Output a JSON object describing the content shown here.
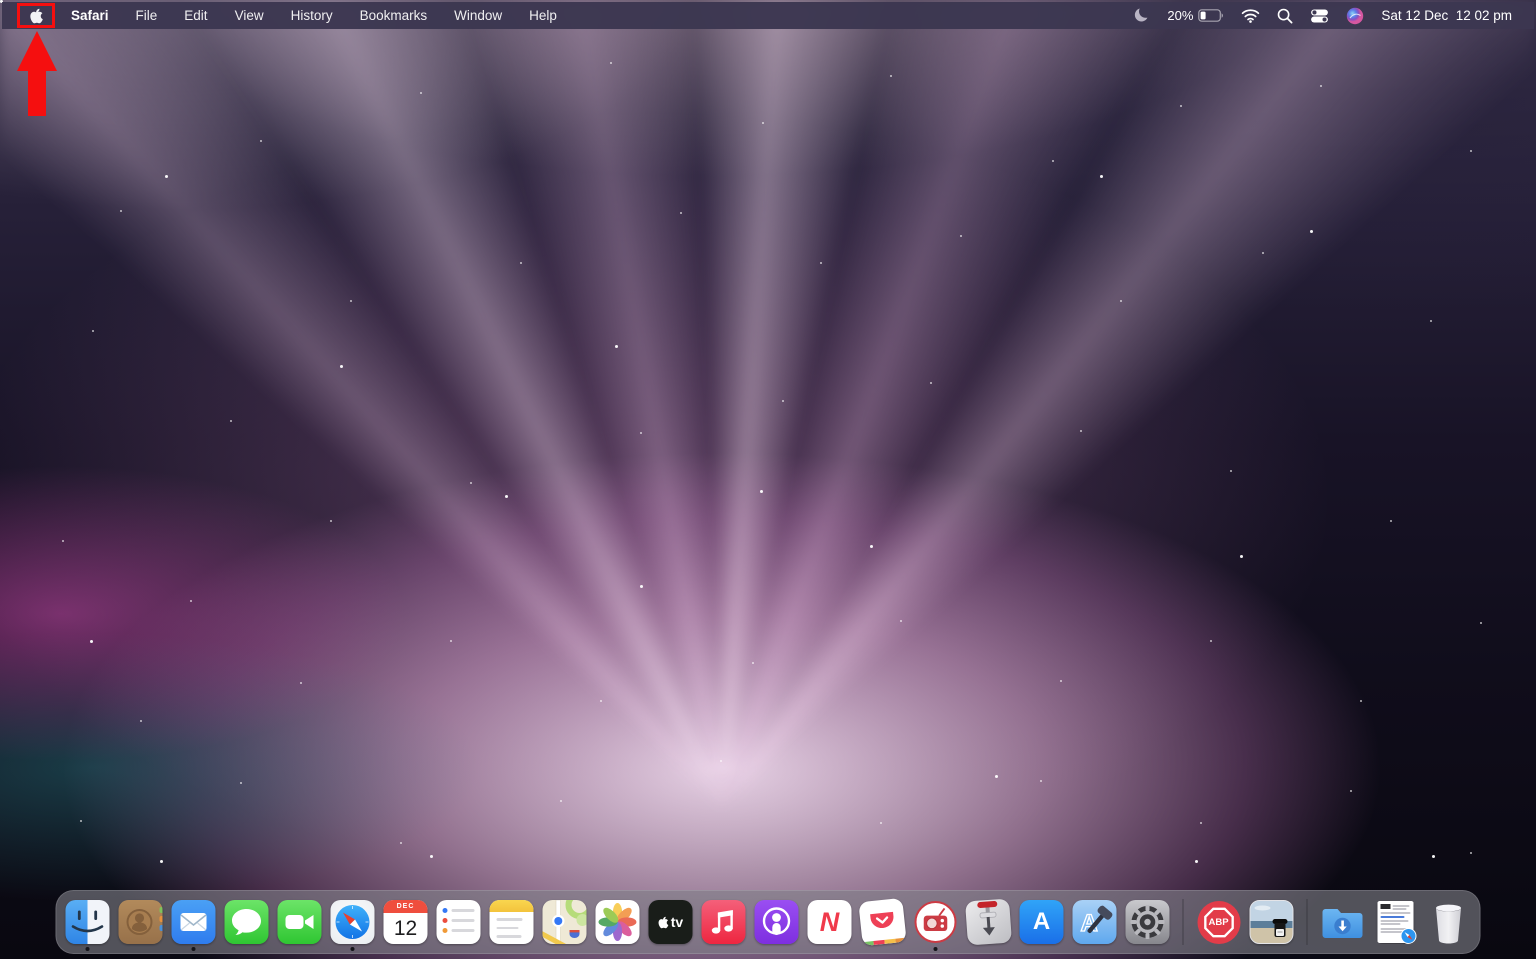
{
  "menubar": {
    "apple_logo": "apple-logo",
    "menus": [
      "Safari",
      "File",
      "Edit",
      "View",
      "History",
      "Bookmarks",
      "Window",
      "Help"
    ],
    "active_app": "Safari",
    "status": {
      "do_not_disturb_icon": "moon-icon",
      "battery_percent": "20%",
      "wifi_icon": "wifi-icon",
      "spotlight_icon": "search-icon",
      "control_center_icon": "control-center-icon",
      "siri_icon": "siri-icon",
      "clock": "Sat 12 Dec  12 02 pm"
    }
  },
  "annotation": {
    "shape": "highlight-box-and-up-arrow",
    "color": "#f50f0f",
    "target": "apple-menu"
  },
  "dock": {
    "items": [
      "Finder",
      "Contacts",
      "Mail",
      "Messages",
      "FaceTime",
      "Safari",
      "Calendar",
      "Reminders",
      "Notes",
      "Maps",
      "Photos",
      "TV",
      "Music",
      "Podcasts",
      "News",
      "Pocket",
      "Broadcasts",
      "Transmission",
      "App Store",
      "Xcode",
      "System Preferences",
      "Adblock Plus",
      "Image File",
      "Downloads",
      "Web Document",
      "Trash"
    ],
    "running": [
      "Finder",
      "Mail",
      "Safari",
      "Broadcasts"
    ],
    "calendar": {
      "month": "DEC",
      "day": "12"
    },
    "tv_label": "tv",
    "appstore_letter": "A",
    "xcode_letter": "A",
    "news_letter": "N",
    "abp_label": "ABP"
  },
  "colors": {
    "menubar_bg": "#3c3751",
    "annotation_red": "#f50f0f",
    "dock_bg": "rgba(127,127,135,0.62)"
  }
}
